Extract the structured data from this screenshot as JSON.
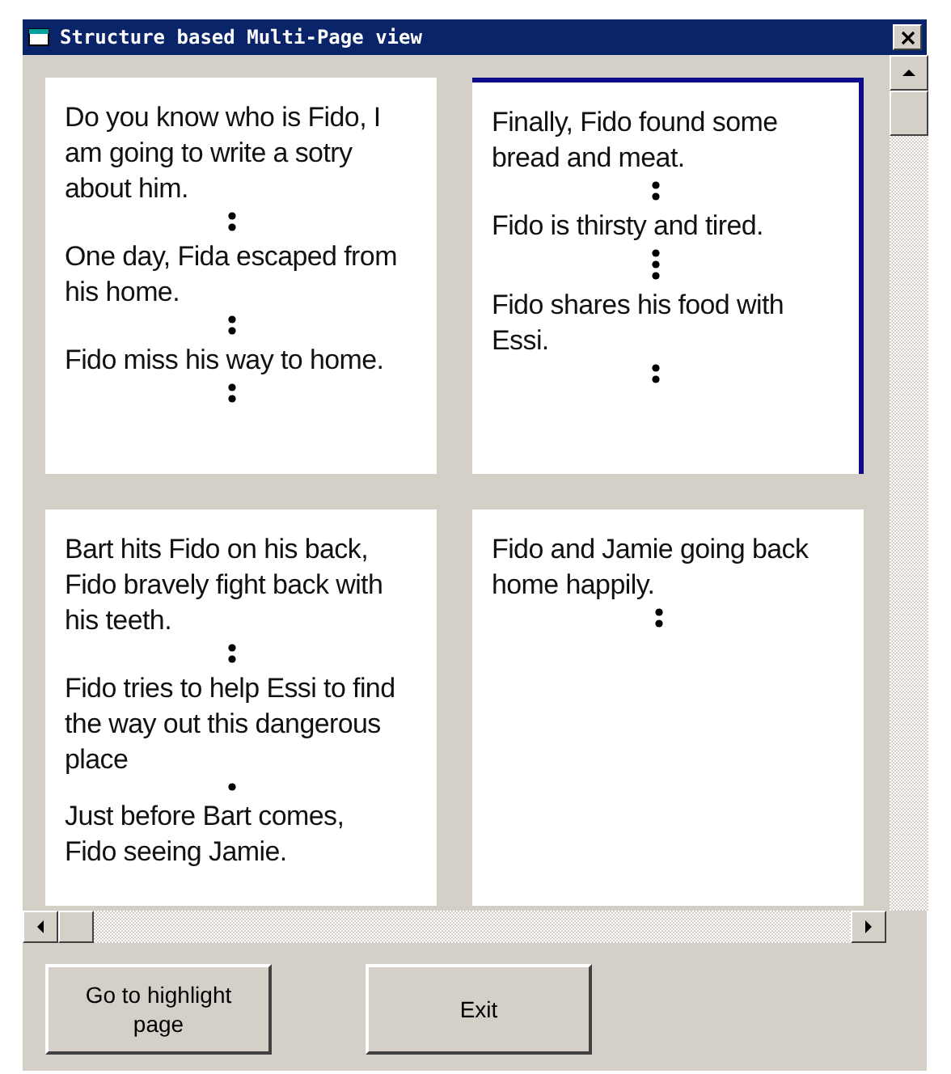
{
  "window": {
    "title": "Structure based Multi-Page view"
  },
  "pages": [
    {
      "highlighted": false,
      "items": [
        {
          "kind": "event",
          "text": "Do you know who is Fido, I am going to write a sotry about him."
        },
        {
          "kind": "pair"
        },
        {
          "kind": "event",
          "text": "One day, Fida escaped from his home."
        },
        {
          "kind": "pair"
        },
        {
          "kind": "event",
          "text": "Fido miss his way to home."
        },
        {
          "kind": "pair"
        }
      ]
    },
    {
      "highlighted": true,
      "items": [
        {
          "kind": "event",
          "text": "Finally, Fido found some bread and meat."
        },
        {
          "kind": "pair"
        },
        {
          "kind": "event",
          "text": "Fido is thirsty and tired."
        },
        {
          "kind": "trio"
        },
        {
          "kind": "event",
          "text": "Fido shares his food with Essi."
        },
        {
          "kind": "pair"
        }
      ]
    },
    {
      "highlighted": false,
      "items": [
        {
          "kind": "event",
          "text": "Bart hits Fido on his back, Fido bravely fight back with his teeth."
        },
        {
          "kind": "pair"
        },
        {
          "kind": "event",
          "text": "Fido tries to help Essi to find the way out this dangerous place"
        },
        {
          "kind": "dot"
        },
        {
          "kind": "event",
          "text": "Just before Bart comes, Fido seeing Jamie."
        }
      ]
    },
    {
      "highlighted": false,
      "items": [
        {
          "kind": "event",
          "text": "Fido and Jamie going back home happily."
        },
        {
          "kind": "pair"
        }
      ]
    }
  ],
  "buttons": [
    {
      "label": "Go to highlight page"
    },
    {
      "label": "Exit"
    }
  ]
}
